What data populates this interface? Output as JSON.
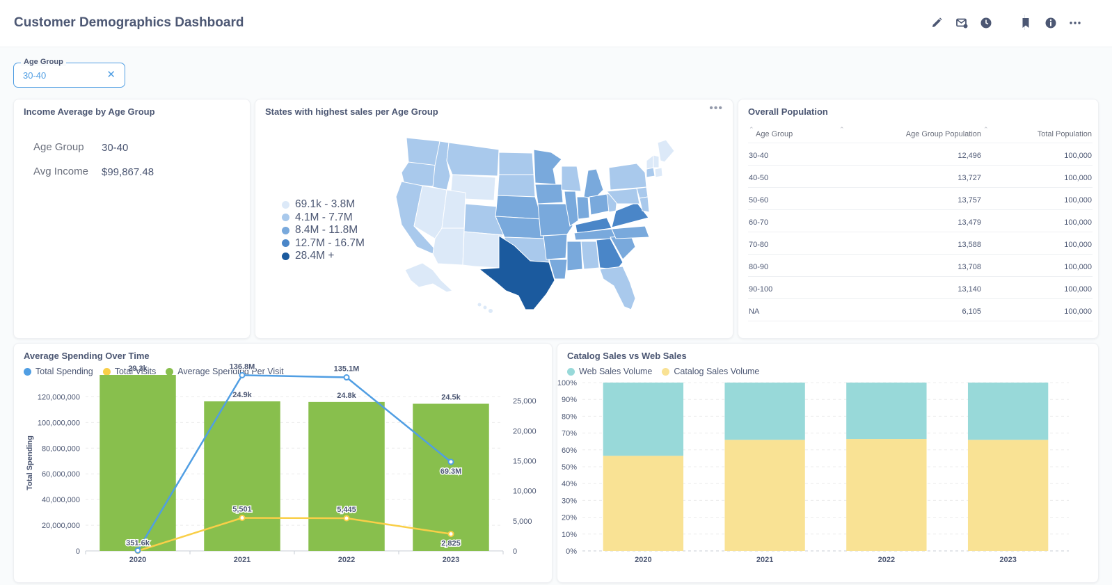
{
  "header": {
    "title": "Customer Demographics Dashboard",
    "icons": [
      "pencil-icon",
      "subscription-icon",
      "history-icon",
      "bookmark-icon",
      "info-icon",
      "more-icon"
    ]
  },
  "filter": {
    "label": "Age Group",
    "value": "30-40"
  },
  "income_card": {
    "title": "Income Average by Age Group",
    "rows": [
      {
        "label": "Age Group",
        "value": "30-40"
      },
      {
        "label": "Avg Income",
        "value": "$99,867.48"
      }
    ]
  },
  "map_card": {
    "title": "States with highest sales per Age Group",
    "legend": [
      {
        "label": "69.1k - 3.8M",
        "color": "#dce9f8"
      },
      {
        "label": "4.1M - 7.7M",
        "color": "#a9c9ec"
      },
      {
        "label": "8.4M - 11.8M",
        "color": "#79a9dc"
      },
      {
        "label": "12.7M - 16.7M",
        "color": "#4a86c8"
      },
      {
        "label": "28.4M +",
        "color": "#1b5a9e"
      }
    ]
  },
  "population_card": {
    "title": "Overall Population",
    "columns": [
      "Age Group",
      "Age Group Population",
      "Total Population"
    ],
    "rows": [
      [
        "30-40",
        "12,496",
        "100,000"
      ],
      [
        "40-50",
        "13,727",
        "100,000"
      ],
      [
        "50-60",
        "13,757",
        "100,000"
      ],
      [
        "60-70",
        "13,479",
        "100,000"
      ],
      [
        "70-80",
        "13,588",
        "100,000"
      ],
      [
        "80-90",
        "13,708",
        "100,000"
      ],
      [
        "90-100",
        "13,140",
        "100,000"
      ],
      [
        "NA",
        "6,105",
        "100,000"
      ]
    ]
  },
  "spending_card": {
    "title": "Average Spending Over Time"
  },
  "catalog_card": {
    "title": "Catalog Sales vs Web Sales"
  },
  "chart_data": [
    {
      "type": "bar",
      "title": "Average Spending Over Time",
      "categories": [
        "2020",
        "2021",
        "2022",
        "2023"
      ],
      "ylabel": "Total Spending",
      "ylim": [
        0,
        137000000
      ],
      "y_ticks": [
        "0",
        "20,000,000",
        "40,000,000",
        "60,000,000",
        "80,000,000",
        "100,000,000",
        "120,000,000"
      ],
      "y2lim": [
        0,
        29300
      ],
      "y2_ticks": [
        "0",
        "5,000",
        "10,000",
        "15,000",
        "20,000",
        "25,000"
      ],
      "series": [
        {
          "name": "Total Spending",
          "kind": "line",
          "axis": "left",
          "color": "#509ee3",
          "values": [
            351600,
            136800000,
            135100000,
            69300000
          ],
          "labels": [
            "351.6k",
            "136.8M",
            "135.1M",
            "69.3M"
          ]
        },
        {
          "name": "Total Visits",
          "kind": "line",
          "axis": "right",
          "color": "#f9cf48",
          "values": [
            0,
            5501,
            5445,
            2825
          ],
          "labels": [
            "",
            "5,501",
            "5,445",
            "2,825"
          ]
        },
        {
          "name": "Average Spending Per Visit",
          "kind": "bar",
          "axis": "right",
          "color": "#88bf4d",
          "values": [
            29300,
            24900,
            24800,
            24500
          ],
          "labels": [
            "29.3k",
            "24.9k",
            "24.8k",
            "24.5k"
          ]
        }
      ],
      "grid": true,
      "legend": "top-left"
    },
    {
      "type": "bar",
      "stacked": "percent",
      "title": "Catalog Sales vs Web Sales",
      "categories": [
        "2020",
        "2021",
        "2022",
        "2023"
      ],
      "ylim": [
        0,
        100
      ],
      "y_ticks": [
        "0%",
        "10%",
        "20%",
        "30%",
        "40%",
        "50%",
        "60%",
        "70%",
        "80%",
        "90%",
        "100%"
      ],
      "series": [
        {
          "name": "Web Sales Volume",
          "color": "#98d9d9",
          "values": [
            43.5,
            34,
            33.5,
            34
          ]
        },
        {
          "name": "Catalog Sales Volume",
          "color": "#f9e294",
          "values": [
            56.5,
            66,
            66.5,
            66
          ]
        }
      ],
      "grid": true,
      "legend": "top-left"
    }
  ]
}
